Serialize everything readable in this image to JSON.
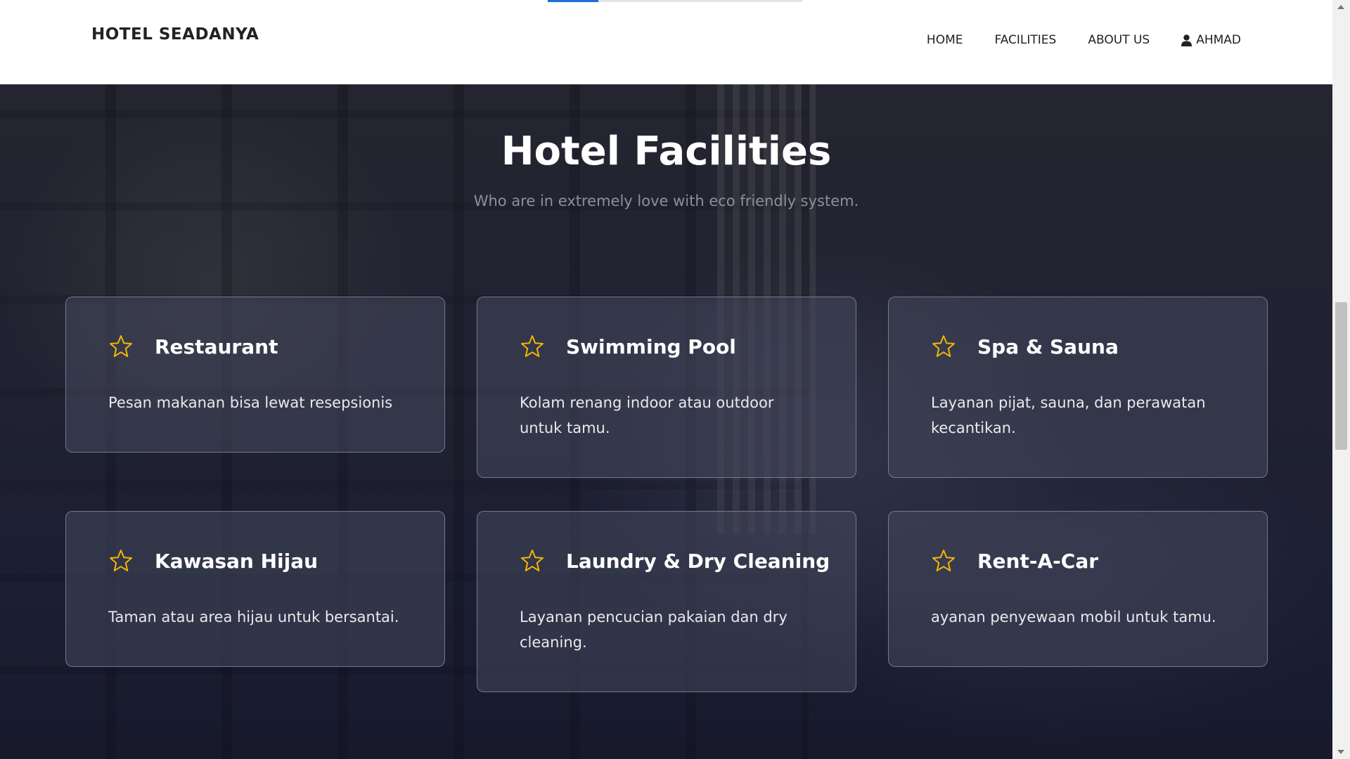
{
  "header": {
    "brand": "HOTEL SEADANYA",
    "scroll_progress": 0.2,
    "nav": {
      "home": "HOME",
      "facilities": "FACILITIES",
      "about": "ABOUT US",
      "user": "AHMAD",
      "user_icon": "user-icon"
    }
  },
  "section": {
    "title": "Hotel Facilities",
    "subtitle": "Who are in extremely love with eco friendly system."
  },
  "facilities": [
    {
      "icon": "star-icon",
      "title": "Restaurant",
      "description": "Pesan makanan bisa lewat resepsionis"
    },
    {
      "icon": "star-icon",
      "title": "Swimming Pool",
      "description": "Kolam renang indoor atau outdoor untuk tamu."
    },
    {
      "icon": "star-icon",
      "title": "Spa & Sauna",
      "description": "Layanan pijat, sauna, dan perawatan kecantikan."
    },
    {
      "icon": "star-icon",
      "title": "Kawasan Hijau",
      "description": "Taman atau area hijau untuk bersantai."
    },
    {
      "icon": "star-icon",
      "title": "Laundry & Dry Cleaning",
      "description": "Layanan pencucian pakaian dan dry cleaning."
    },
    {
      "icon": "star-icon",
      "title": "Rent-A-Car",
      "description": "ayanan penyewaan mobil untuk tamu."
    }
  ],
  "colors": {
    "accent_star": "#f2b705",
    "progress": "#1e6fd9",
    "card_border": "#c8c8d7"
  }
}
